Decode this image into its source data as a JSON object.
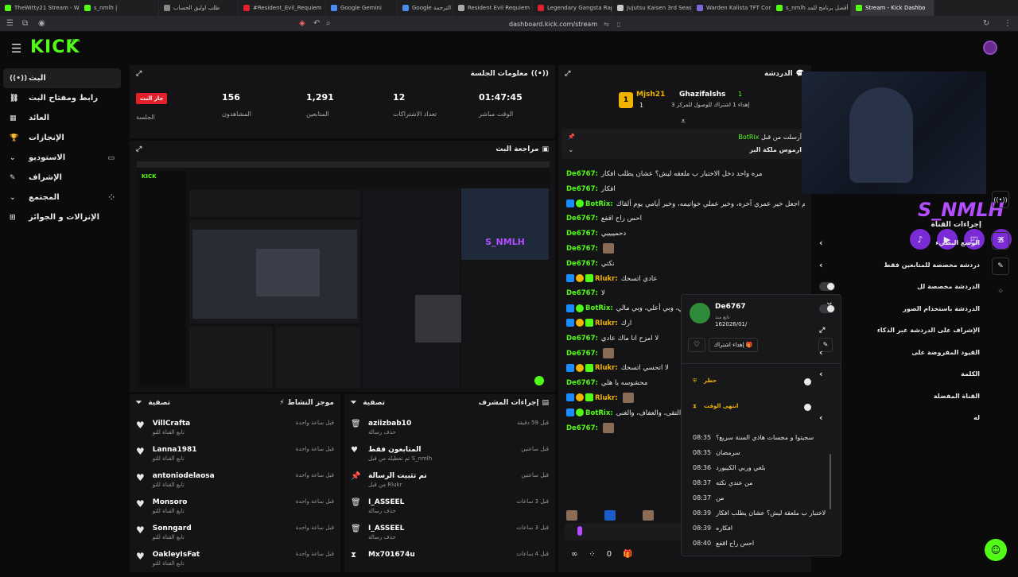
{
  "browser": {
    "tabs": [
      {
        "label": "TheWitty21 Stream - Watc",
        "active": false
      },
      {
        "label": "s_nmlh |",
        "active": false
      },
      {
        "label": "طلب اوليق الحساب",
        "active": false
      },
      {
        "label": "#Resident_Evil_Requiem",
        "active": false
      },
      {
        "label": "Google Gemini",
        "active": false
      },
      {
        "label": "Google الترجمة",
        "active": false
      },
      {
        "label": "Resident Evil Requiem - بحث",
        "active": false
      },
      {
        "label": "Legendary Gangsta Rap from",
        "active": false
      },
      {
        "label": "Jujutsu Kaisen 3rd Season",
        "active": false
      },
      {
        "label": "Warden Kalista TFT Comp Guid",
        "active": false
      },
      {
        "label": "s_nmlh مخير | أفضل برنامج للمد",
        "active": false
      },
      {
        "label": "Stream - Kick Dashbo",
        "active": true
      }
    ],
    "url": "dashboard.kick.com/stream"
  },
  "header": {
    "logo": "KICK",
    "beta": "BETA"
  },
  "sidebar": {
    "items": [
      {
        "label": "البث",
        "icon": "broadcast-icon",
        "active": true
      },
      {
        "label": "رابط ومفتاح البث",
        "icon": "link-icon"
      },
      {
        "label": "العائد",
        "icon": "revenue-icon"
      },
      {
        "label": "الإنجازات",
        "icon": "trophy-icon"
      },
      {
        "label": "الاستوديو",
        "icon": "chevron-down-icon"
      },
      {
        "label": "الإشراف",
        "icon": "wrench-icon"
      },
      {
        "label": "المجتمع",
        "icon": "chevron-down-icon"
      },
      {
        "label": "الإنزالات و الجوائز",
        "icon": "gift-icon"
      }
    ]
  },
  "session": {
    "title": "معلومات الجلسة",
    "live_badge": "جار البث",
    "live_label": "الجلسة",
    "stats": [
      {
        "value": "156",
        "label": "المشاهدون"
      },
      {
        "value": "1,291",
        "label": "المتابعين"
      },
      {
        "value": "12",
        "label": "تعداد الاشتراكات"
      },
      {
        "value": "01:47:45",
        "label": "الوقت مباشر"
      }
    ]
  },
  "preview": {
    "title": "مراجعة البث"
  },
  "activity": {
    "title": "موجز النشاط",
    "filter": "تصفية",
    "items": [
      {
        "name": "VillCrafta",
        "sub": "تابع القناة للتو",
        "time": "قبل ساعة واحدة"
      },
      {
        "name": "Lanna1981",
        "sub": "تابع القناة للتو",
        "time": "قبل ساعة واحدة"
      },
      {
        "name": "antoniodelaosa",
        "sub": "تابع القناة للتو",
        "time": "قبل ساعة واحدة"
      },
      {
        "name": "Monsoro",
        "sub": "تابع القناة للتو",
        "time": "قبل ساعة واحدة"
      },
      {
        "name": "Sonngard",
        "sub": "تابع القناة للتو",
        "time": "قبل ساعة واحدة"
      },
      {
        "name": "OakleyIsFat",
        "sub": "تابع القناة للتو",
        "time": "قبل ساعة واحدة"
      }
    ]
  },
  "modactions": {
    "title": "إجراءات المشرف",
    "filter": "تصفية",
    "items": [
      {
        "name": "aziizbab10",
        "sub": "حذف رسالة",
        "time": "قبل 59 دقيقة",
        "icon": "trash-icon"
      },
      {
        "name": "المتابعون فقط",
        "sub": "تم تعطيله من قبل S_nmlh",
        "time": "قبل ساعتين",
        "icon": "heart-icon"
      },
      {
        "name": "تم تثبيت الرسالة",
        "sub": "من قبل Rlukr",
        "time": "قبل ساعتين",
        "icon": "pin-icon"
      },
      {
        "name": "I_ASSEEL",
        "sub": "حذف رسالة",
        "time": "قبل 3 ساعات",
        "icon": "trash-icon"
      },
      {
        "name": "I_ASSEEL",
        "sub": "حذف رسالة",
        "time": "قبل 3 ساعات",
        "icon": "trash-icon"
      },
      {
        "name": "Mx701674u",
        "sub": "",
        "time": "قبل 4 ساعات",
        "icon": "hourglass-icon"
      }
    ]
  },
  "chat": {
    "title": "الدردشة",
    "gifter": "Mjsh21",
    "gifter_count": "1",
    "recipient": "Ghazifalshs",
    "recipient_count": "1",
    "gift_text": "إهداء 1 اشتراك للوصول للمركز 3",
    "pinned_by": "أرسلت من قبل",
    "pinned_user": "BotRix",
    "pinned_text": "ارموس ملكة البر",
    "messages": [
      {
        "user": "De6767:",
        "text": "مره واحد دخل الاختبار ب ملعقه ليش؟ عشان يطلب افكار"
      },
      {
        "user": "De6767:",
        "text": "افكار"
      },
      {
        "user": "BotRix:",
        "text": "اللهم اجعل خير عمري آخره، وخير عملي خواتيمه، وخير أيامي يوم ألقاك"
      },
      {
        "user": "De6767:",
        "text": "احس راح اقفع"
      },
      {
        "user": "De6767:",
        "text": "دحمييييي"
      },
      {
        "user": "De6767:",
        "text": ""
      },
      {
        "user": "De6767:",
        "text": "نكتي"
      },
      {
        "user": "Rlukr:",
        "text": "عادي اتسحك"
      },
      {
        "user": "De6767:",
        "text": "لا"
      },
      {
        "user": "BotRix:",
        "text": "ملي، وبي أعلي، وبي مالي"
      },
      {
        "user": "Rlukr:",
        "text": "ارك"
      },
      {
        "user": "De6767:",
        "text": "لا امزح انا ماك عادي"
      },
      {
        "user": "De6767:",
        "text": ""
      },
      {
        "user": "Rlukr:",
        "text": "لا اتحسي اتسحك"
      },
      {
        "user": "De6767:",
        "text": "محشوسه يا هلي"
      },
      {
        "user": "Rlukr:",
        "text": ""
      },
      {
        "user": "BotRix:",
        "text": "والتقى، والعفاف، والغنى"
      },
      {
        "user": "De6767:",
        "text": ""
      }
    ],
    "footer_count": "0"
  },
  "usercard": {
    "username": "De6767",
    "followed_label": "تابع منذ",
    "followed_date": "162026/01/",
    "gift_btn": "إهداء اشتراك",
    "ban_label": "حظر",
    "timeout_label": "انتهى الوقت",
    "history": [
      {
        "time": "08:35",
        "text": "سجيتوا و مجسات هاذي السنة سريع؟"
      },
      {
        "time": "08:35",
        "text": "سرمضان"
      },
      {
        "time": "08:36",
        "text": "بلغي وربي الكيبورد"
      },
      {
        "time": "08:37",
        "text": "من عندي نكته"
      },
      {
        "time": "08:37",
        "text": "من"
      },
      {
        "time": "08:39",
        "text": "مره واحد دخل الاختبار ب ملعقة ليش؟ عشان يطلب افكار"
      },
      {
        "time": "08:39",
        "text": "افكاره"
      },
      {
        "time": "08:40",
        "text": "احس راح اقفع"
      }
    ]
  },
  "rightpanel": {
    "title": "إجراءات القناة",
    "items": [
      {
        "label": "الوضع البطيء",
        "type": "chevron"
      },
      {
        "label": "دردشة مخصصة للمتابعين فقط",
        "type": "chevron"
      },
      {
        "label": "الدردشة مخصصة لل",
        "type": "toggle"
      },
      {
        "label": "الدردشة باستخدام الصور",
        "type": "toggle"
      },
      {
        "label": "الإشراف على الدردشة عبر الذكاء",
        "type": "external"
      },
      {
        "label": "القيود المفروضة على",
        "type": "chevron"
      },
      {
        "label": "الكلمة",
        "type": "chevron"
      },
      {
        "label": "القناة المفضلة",
        "type": "none"
      },
      {
        "label": "له",
        "type": "chevron"
      }
    ]
  },
  "webcam": {
    "overlay_name": "S_NMLH"
  },
  "colors": {
    "accent": "#53fc18",
    "live": "#e2202b",
    "panel": "#141416",
    "bg": "#0b0b0c"
  }
}
